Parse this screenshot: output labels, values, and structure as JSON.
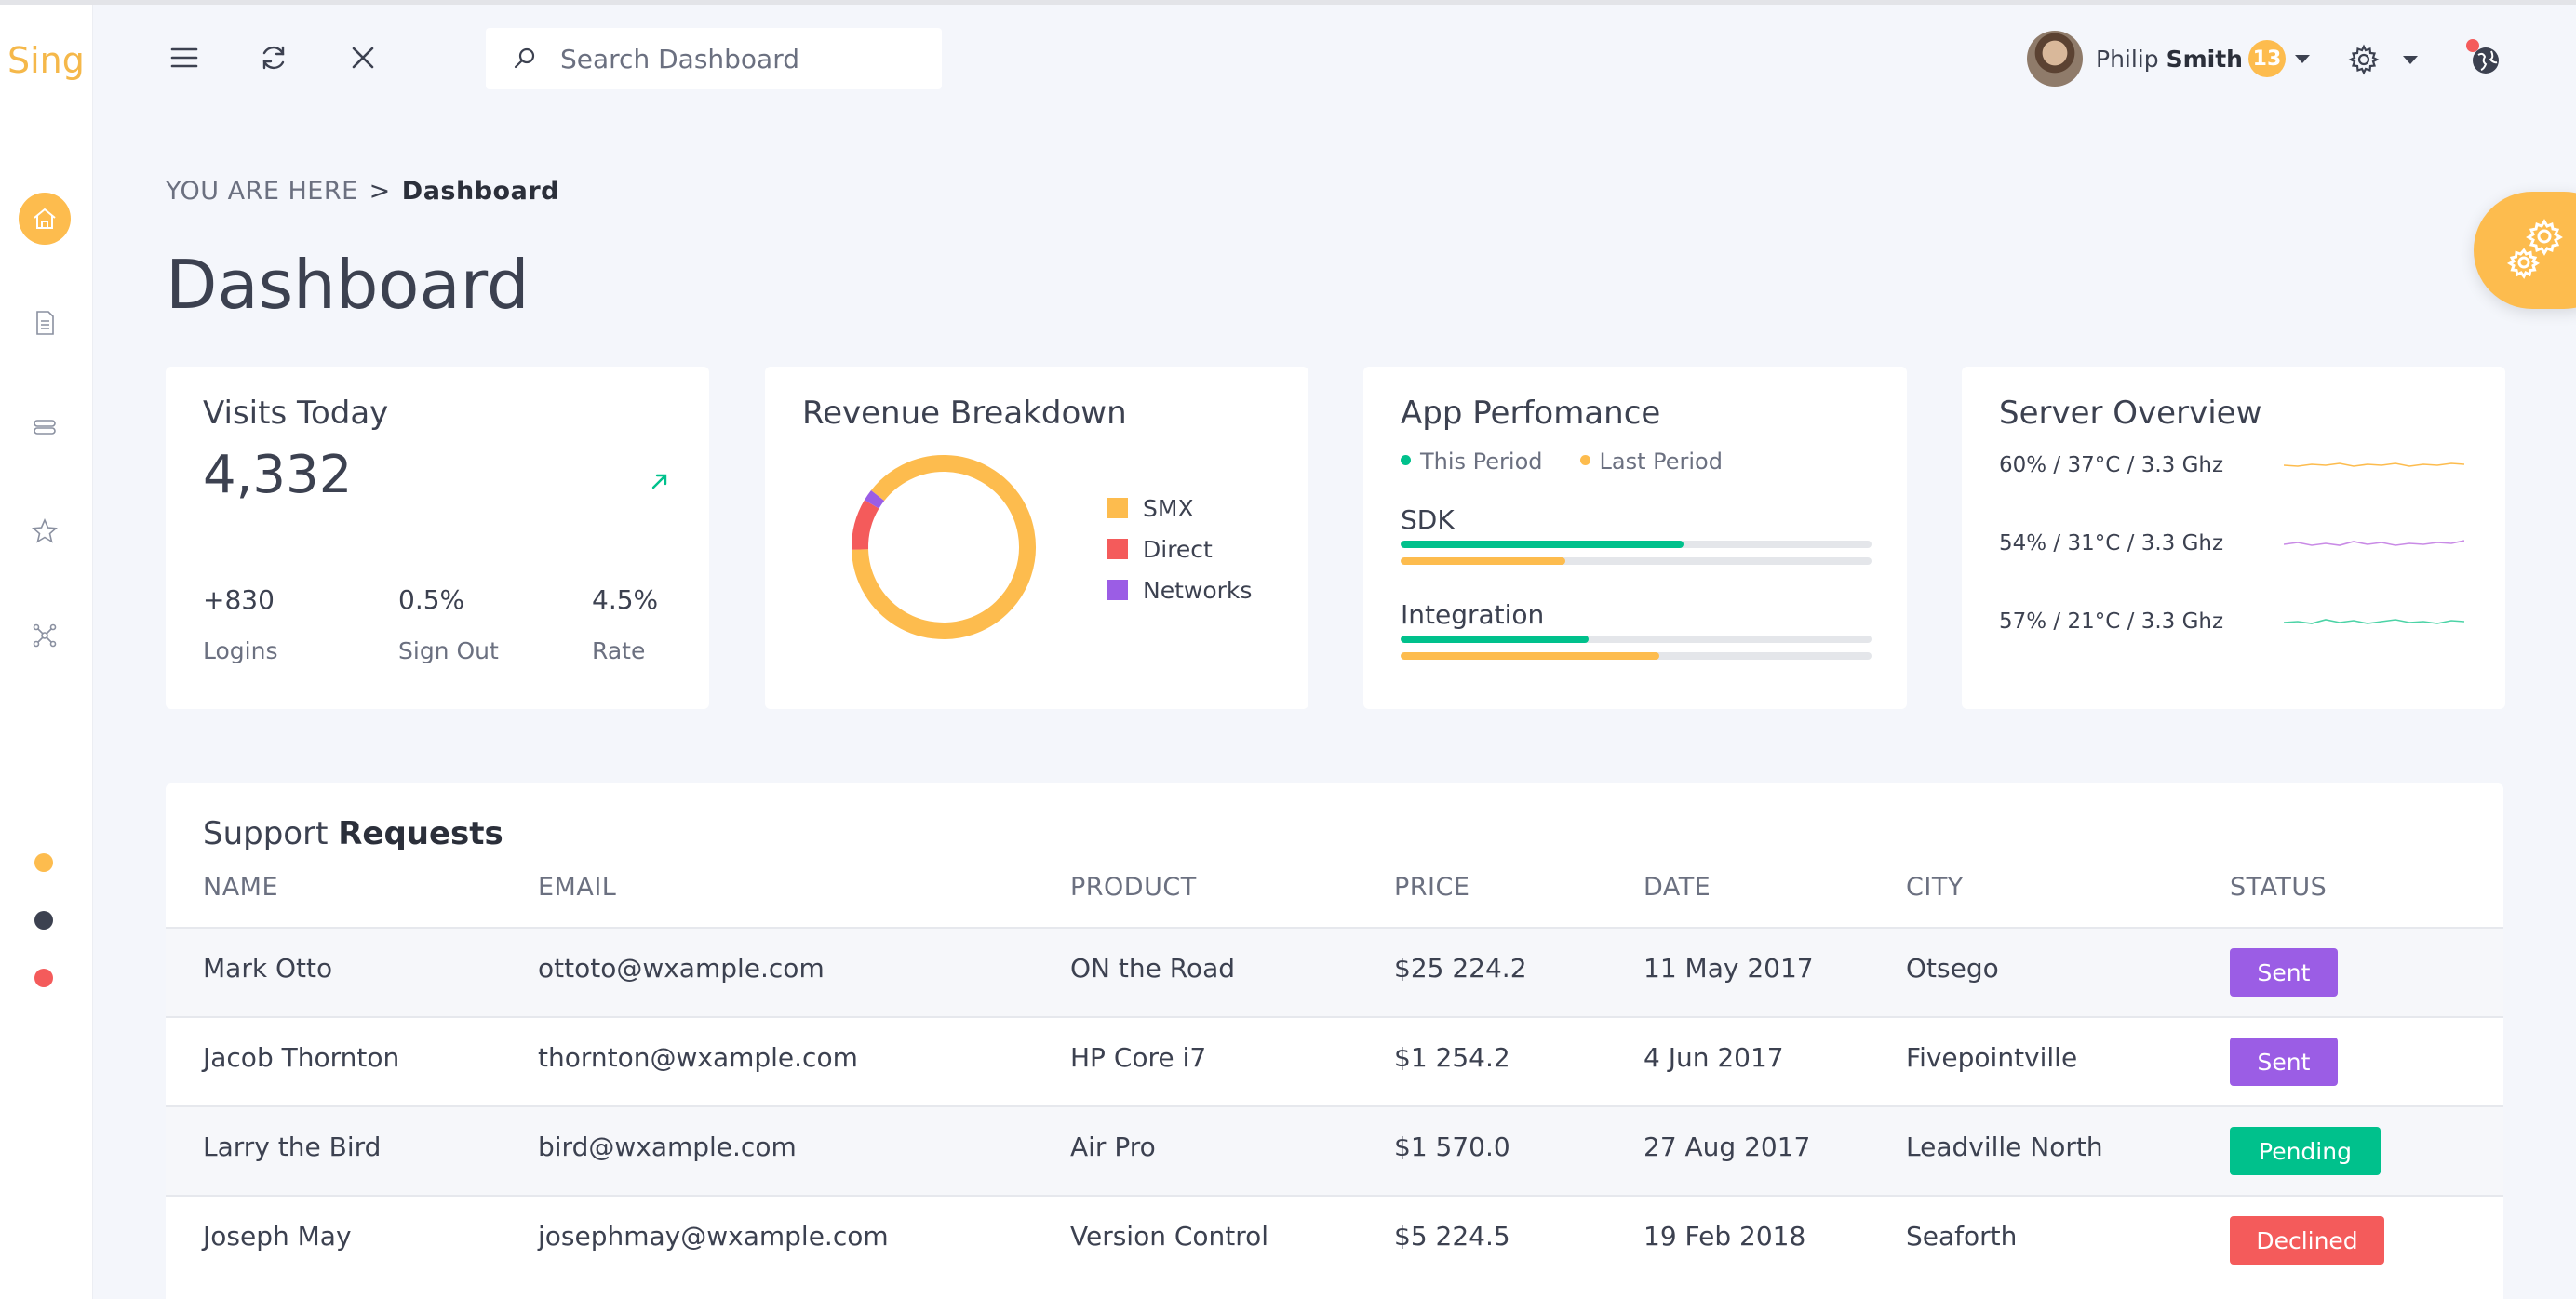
{
  "brand": "Sing",
  "search": {
    "placeholder": "Search Dashboard"
  },
  "user": {
    "first": "Philip",
    "last": "Smith",
    "badge": "13"
  },
  "breadcrumb": {
    "prefix": "YOU ARE HERE",
    "separator": ">",
    "current": "Dashboard"
  },
  "page_title": "Dashboard",
  "colors": {
    "accent": "#fdbc4e",
    "red": "#f45b5b",
    "purple": "#9b5de5",
    "green": "#00c18c"
  },
  "visits": {
    "title": "Visits Today",
    "value": "4,332",
    "stats": [
      {
        "value": "+830",
        "label": "Logins"
      },
      {
        "value": "0.5%",
        "label": "Sign Out"
      },
      {
        "value": "4.5%",
        "label": "Rate"
      }
    ]
  },
  "revenue": {
    "title": "Revenue Breakdown",
    "legend": [
      "SMX",
      "Direct",
      "Networks"
    ],
    "chart_data": {
      "type": "pie",
      "categories": [
        "SMX",
        "Direct",
        "Networks"
      ],
      "values": [
        89,
        9,
        2
      ],
      "colors": [
        "#fdbc4e",
        "#f45b5b",
        "#9b5de5"
      ]
    }
  },
  "performance": {
    "title": "App Perfomance",
    "legend": [
      "This Period",
      "Last Period"
    ],
    "rows": [
      {
        "label": "SDK",
        "this": 60,
        "last": 35
      },
      {
        "label": "Integration",
        "this": 40,
        "last": 55
      }
    ]
  },
  "server": {
    "title": "Server Overview",
    "rows": [
      {
        "text": "60% / 37°C / 3.3 Ghz",
        "color": "#fdbc4e"
      },
      {
        "text": "54% / 31°C / 3.3 Ghz",
        "color": "#c98be6"
      },
      {
        "text": "57% / 21°C / 3.3 Ghz",
        "color": "#4cd3a6"
      }
    ]
  },
  "support": {
    "title_regular": "Support",
    "title_bold": "Requests",
    "columns": [
      "NAME",
      "EMAIL",
      "PRODUCT",
      "PRICE",
      "DATE",
      "CITY",
      "STATUS"
    ],
    "rows": [
      {
        "name": "Mark Otto",
        "email": "ottoto@wxample.com",
        "product": "ON the Road",
        "price": "$25 224.2",
        "date": "11 May 2017",
        "city": "Otsego",
        "status": "Sent",
        "status_color": "#9b5de5"
      },
      {
        "name": "Jacob Thornton",
        "email": "thornton@wxample.com",
        "product": "HP Core i7",
        "price": "$1 254.2",
        "date": "4 Jun 2017",
        "city": "Fivepointville",
        "status": "Sent",
        "status_color": "#9b5de5"
      },
      {
        "name": "Larry the Bird",
        "email": "bird@wxample.com",
        "product": "Air Pro",
        "price": "$1 570.0",
        "date": "27 Aug 2017",
        "city": "Leadville North",
        "status": "Pending",
        "status_color": "#00c18c"
      },
      {
        "name": "Joseph May",
        "email": "josephmay@wxample.com",
        "product": "Version Control",
        "price": "$5 224.5",
        "date": "19 Feb 2018",
        "city": "Seaforth",
        "status": "Declined",
        "status_color": "#f45b5b"
      }
    ]
  }
}
